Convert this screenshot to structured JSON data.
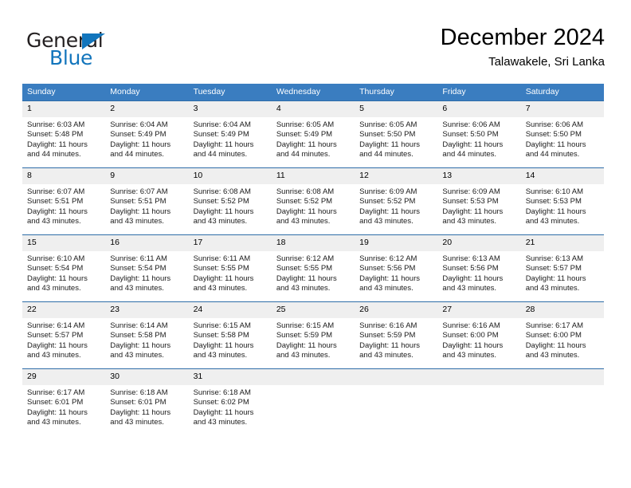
{
  "brand": {
    "name_part1": "General",
    "name_part2": "Blue",
    "triangle_color": "#1275bc"
  },
  "header": {
    "title": "December 2024",
    "location": "Talawakele, Sri Lanka"
  },
  "calendar": {
    "header_bg": "#3a7dc0",
    "daynum_bg": "#efefef",
    "columns": [
      "Sunday",
      "Monday",
      "Tuesday",
      "Wednesday",
      "Thursday",
      "Friday",
      "Saturday"
    ],
    "weeks": [
      [
        {
          "day": "1",
          "sunrise": "Sunrise: 6:03 AM",
          "sunset": "Sunset: 5:48 PM",
          "daylight_line1": "Daylight: 11 hours",
          "daylight_line2": "and 44 minutes."
        },
        {
          "day": "2",
          "sunrise": "Sunrise: 6:04 AM",
          "sunset": "Sunset: 5:49 PM",
          "daylight_line1": "Daylight: 11 hours",
          "daylight_line2": "and 44 minutes."
        },
        {
          "day": "3",
          "sunrise": "Sunrise: 6:04 AM",
          "sunset": "Sunset: 5:49 PM",
          "daylight_line1": "Daylight: 11 hours",
          "daylight_line2": "and 44 minutes."
        },
        {
          "day": "4",
          "sunrise": "Sunrise: 6:05 AM",
          "sunset": "Sunset: 5:49 PM",
          "daylight_line1": "Daylight: 11 hours",
          "daylight_line2": "and 44 minutes."
        },
        {
          "day": "5",
          "sunrise": "Sunrise: 6:05 AM",
          "sunset": "Sunset: 5:50 PM",
          "daylight_line1": "Daylight: 11 hours",
          "daylight_line2": "and 44 minutes."
        },
        {
          "day": "6",
          "sunrise": "Sunrise: 6:06 AM",
          "sunset": "Sunset: 5:50 PM",
          "daylight_line1": "Daylight: 11 hours",
          "daylight_line2": "and 44 minutes."
        },
        {
          "day": "7",
          "sunrise": "Sunrise: 6:06 AM",
          "sunset": "Sunset: 5:50 PM",
          "daylight_line1": "Daylight: 11 hours",
          "daylight_line2": "and 44 minutes."
        }
      ],
      [
        {
          "day": "8",
          "sunrise": "Sunrise: 6:07 AM",
          "sunset": "Sunset: 5:51 PM",
          "daylight_line1": "Daylight: 11 hours",
          "daylight_line2": "and 43 minutes."
        },
        {
          "day": "9",
          "sunrise": "Sunrise: 6:07 AM",
          "sunset": "Sunset: 5:51 PM",
          "daylight_line1": "Daylight: 11 hours",
          "daylight_line2": "and 43 minutes."
        },
        {
          "day": "10",
          "sunrise": "Sunrise: 6:08 AM",
          "sunset": "Sunset: 5:52 PM",
          "daylight_line1": "Daylight: 11 hours",
          "daylight_line2": "and 43 minutes."
        },
        {
          "day": "11",
          "sunrise": "Sunrise: 6:08 AM",
          "sunset": "Sunset: 5:52 PM",
          "daylight_line1": "Daylight: 11 hours",
          "daylight_line2": "and 43 minutes."
        },
        {
          "day": "12",
          "sunrise": "Sunrise: 6:09 AM",
          "sunset": "Sunset: 5:52 PM",
          "daylight_line1": "Daylight: 11 hours",
          "daylight_line2": "and 43 minutes."
        },
        {
          "day": "13",
          "sunrise": "Sunrise: 6:09 AM",
          "sunset": "Sunset: 5:53 PM",
          "daylight_line1": "Daylight: 11 hours",
          "daylight_line2": "and 43 minutes."
        },
        {
          "day": "14",
          "sunrise": "Sunrise: 6:10 AM",
          "sunset": "Sunset: 5:53 PM",
          "daylight_line1": "Daylight: 11 hours",
          "daylight_line2": "and 43 minutes."
        }
      ],
      [
        {
          "day": "15",
          "sunrise": "Sunrise: 6:10 AM",
          "sunset": "Sunset: 5:54 PM",
          "daylight_line1": "Daylight: 11 hours",
          "daylight_line2": "and 43 minutes."
        },
        {
          "day": "16",
          "sunrise": "Sunrise: 6:11 AM",
          "sunset": "Sunset: 5:54 PM",
          "daylight_line1": "Daylight: 11 hours",
          "daylight_line2": "and 43 minutes."
        },
        {
          "day": "17",
          "sunrise": "Sunrise: 6:11 AM",
          "sunset": "Sunset: 5:55 PM",
          "daylight_line1": "Daylight: 11 hours",
          "daylight_line2": "and 43 minutes."
        },
        {
          "day": "18",
          "sunrise": "Sunrise: 6:12 AM",
          "sunset": "Sunset: 5:55 PM",
          "daylight_line1": "Daylight: 11 hours",
          "daylight_line2": "and 43 minutes."
        },
        {
          "day": "19",
          "sunrise": "Sunrise: 6:12 AM",
          "sunset": "Sunset: 5:56 PM",
          "daylight_line1": "Daylight: 11 hours",
          "daylight_line2": "and 43 minutes."
        },
        {
          "day": "20",
          "sunrise": "Sunrise: 6:13 AM",
          "sunset": "Sunset: 5:56 PM",
          "daylight_line1": "Daylight: 11 hours",
          "daylight_line2": "and 43 minutes."
        },
        {
          "day": "21",
          "sunrise": "Sunrise: 6:13 AM",
          "sunset": "Sunset: 5:57 PM",
          "daylight_line1": "Daylight: 11 hours",
          "daylight_line2": "and 43 minutes."
        }
      ],
      [
        {
          "day": "22",
          "sunrise": "Sunrise: 6:14 AM",
          "sunset": "Sunset: 5:57 PM",
          "daylight_line1": "Daylight: 11 hours",
          "daylight_line2": "and 43 minutes."
        },
        {
          "day": "23",
          "sunrise": "Sunrise: 6:14 AM",
          "sunset": "Sunset: 5:58 PM",
          "daylight_line1": "Daylight: 11 hours",
          "daylight_line2": "and 43 minutes."
        },
        {
          "day": "24",
          "sunrise": "Sunrise: 6:15 AM",
          "sunset": "Sunset: 5:58 PM",
          "daylight_line1": "Daylight: 11 hours",
          "daylight_line2": "and 43 minutes."
        },
        {
          "day": "25",
          "sunrise": "Sunrise: 6:15 AM",
          "sunset": "Sunset: 5:59 PM",
          "daylight_line1": "Daylight: 11 hours",
          "daylight_line2": "and 43 minutes."
        },
        {
          "day": "26",
          "sunrise": "Sunrise: 6:16 AM",
          "sunset": "Sunset: 5:59 PM",
          "daylight_line1": "Daylight: 11 hours",
          "daylight_line2": "and 43 minutes."
        },
        {
          "day": "27",
          "sunrise": "Sunrise: 6:16 AM",
          "sunset": "Sunset: 6:00 PM",
          "daylight_line1": "Daylight: 11 hours",
          "daylight_line2": "and 43 minutes."
        },
        {
          "day": "28",
          "sunrise": "Sunrise: 6:17 AM",
          "sunset": "Sunset: 6:00 PM",
          "daylight_line1": "Daylight: 11 hours",
          "daylight_line2": "and 43 minutes."
        }
      ],
      [
        {
          "day": "29",
          "sunrise": "Sunrise: 6:17 AM",
          "sunset": "Sunset: 6:01 PM",
          "daylight_line1": "Daylight: 11 hours",
          "daylight_line2": "and 43 minutes."
        },
        {
          "day": "30",
          "sunrise": "Sunrise: 6:18 AM",
          "sunset": "Sunset: 6:01 PM",
          "daylight_line1": "Daylight: 11 hours",
          "daylight_line2": "and 43 minutes."
        },
        {
          "day": "31",
          "sunrise": "Sunrise: 6:18 AM",
          "sunset": "Sunset: 6:02 PM",
          "daylight_line1": "Daylight: 11 hours",
          "daylight_line2": "and 43 minutes."
        },
        {
          "day": "",
          "sunrise": "",
          "sunset": "",
          "daylight_line1": "",
          "daylight_line2": ""
        },
        {
          "day": "",
          "sunrise": "",
          "sunset": "",
          "daylight_line1": "",
          "daylight_line2": ""
        },
        {
          "day": "",
          "sunrise": "",
          "sunset": "",
          "daylight_line1": "",
          "daylight_line2": ""
        },
        {
          "day": "",
          "sunrise": "",
          "sunset": "",
          "daylight_line1": "",
          "daylight_line2": ""
        }
      ]
    ]
  }
}
